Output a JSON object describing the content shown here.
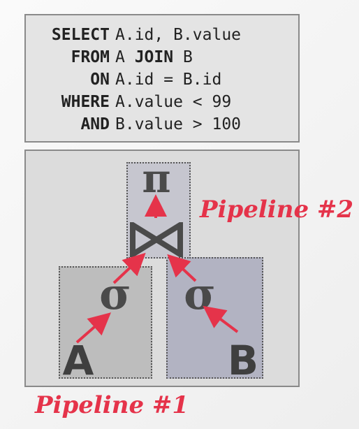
{
  "sql": {
    "lines": [
      {
        "keyword": "SELECT",
        "parts": [
          {
            "t": "A.id, B.value",
            "b": false
          }
        ]
      },
      {
        "keyword": "FROM",
        "parts": [
          {
            "t": "A ",
            "b": false
          },
          {
            "t": "JOIN",
            "b": true
          },
          {
            "t": " B",
            "b": false
          }
        ]
      },
      {
        "keyword": "ON",
        "parts": [
          {
            "t": "A.id = B.id",
            "b": false
          }
        ]
      },
      {
        "keyword": "WHERE",
        "parts": [
          {
            "t": "A.value < 99",
            "b": false
          }
        ]
      },
      {
        "keyword": "AND",
        "parts": [
          {
            "t": "B.value > 100",
            "b": false
          }
        ]
      }
    ]
  },
  "plan": {
    "projection": "π",
    "join": "⋈",
    "select_a": "σ",
    "select_b": "σ",
    "table_a": "A",
    "table_b": "B"
  },
  "labels": {
    "pipeline1": "Pipeline #1",
    "pipeline2": "Pipeline #2"
  },
  "colors": {
    "arrow": "#e5334a",
    "label": "#e5334a"
  }
}
